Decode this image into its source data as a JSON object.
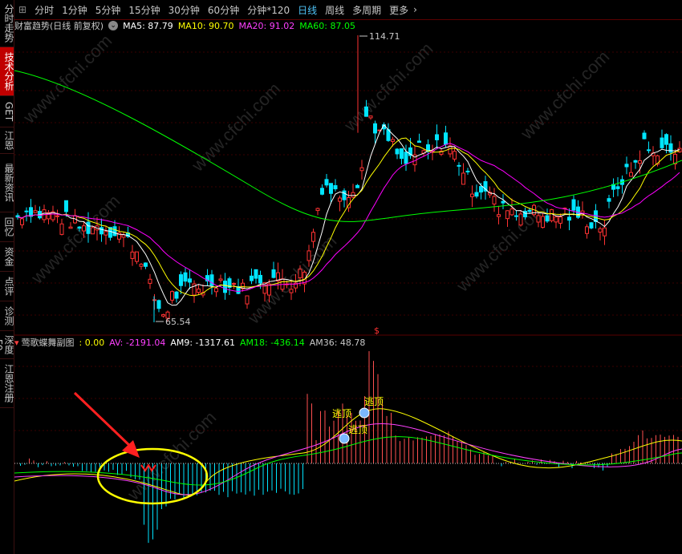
{
  "sidebar": {
    "items": [
      {
        "label": "分时走势",
        "active": false
      },
      {
        "label": "技术分析",
        "active": true
      },
      {
        "label": "GET",
        "active": false
      },
      {
        "label": "江恩",
        "active": false
      },
      {
        "label": "最新资讯",
        "active": false
      },
      {
        "label": "回忆",
        "active": false
      },
      {
        "label": "资金",
        "active": false
      },
      {
        "label": "点评",
        "active": false
      },
      {
        "label": "诊测",
        "active": false
      },
      {
        "label": "深度F9",
        "active": false
      },
      {
        "label": "江恩注册",
        "active": false
      }
    ]
  },
  "toolbar": {
    "periods": [
      "分时",
      "1分钟",
      "5分钟",
      "15分钟",
      "30分钟",
      "60分钟",
      "分钟*120",
      "日线",
      "周线",
      "多周期",
      "更多"
    ],
    "active_period": "日线"
  },
  "main_legend": {
    "title": "财富趋势(日线 前复权)",
    "ma5": "MA5: 87.79",
    "ma10": "MA10: 90.70",
    "ma20": "MA20: 91.02",
    "ma60": "MA60: 87.05"
  },
  "main_chart": {
    "high_label": "114.71",
    "low_label": "65.54",
    "marker": "$",
    "colors": {
      "up": "#ff3232",
      "down": "#00e5ff",
      "ma5": "#ffffff",
      "ma10": "#ffff00",
      "ma20": "#ff00ff",
      "ma60": "#00ff00"
    }
  },
  "sub_legend": {
    "title": "莺歌蝶舞副图",
    "v0": ": 0.00",
    "av": "AV: -2191.04",
    "am9": "AM9: -1317.61",
    "am18": "AM18: -436.14",
    "am36": "AM36: 48.78"
  },
  "sub_chart": {
    "annotations": [
      "逃顶",
      "逃顶",
      "逃顶"
    ]
  },
  "watermarks": [
    "www.cfchi.com",
    "www.cfchi.com",
    "www.cfchi.com",
    "www.cfchi.com",
    "www.cfchi.com",
    "www.cfchi.com",
    "www.cfchi.com",
    "www.cfchi.com"
  ]
}
